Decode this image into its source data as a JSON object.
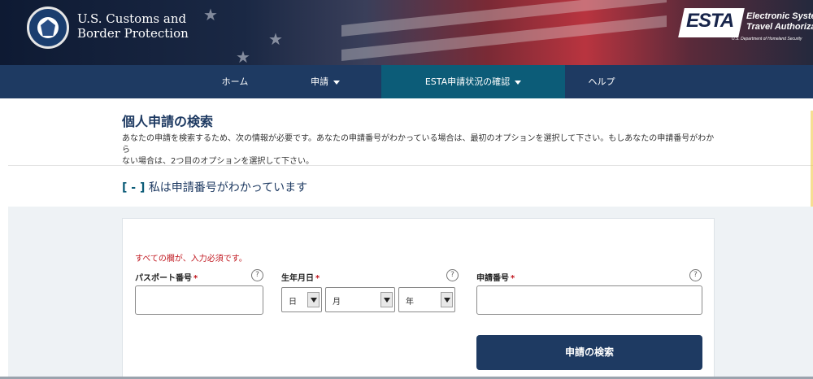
{
  "header": {
    "agency_line1": "U.S. Customs and",
    "agency_line2": "Border Protection",
    "esta_logo": "ESTA",
    "esta_line1": "Electronic System f",
    "esta_line2": "Travel Authorization",
    "esta_dhs": "U.S. Department of Homeland Security"
  },
  "nav": {
    "items": [
      {
        "label": "ホーム"
      },
      {
        "label": "申請"
      },
      {
        "label": "ESTA申請状況の確認"
      },
      {
        "label": "ヘルプ"
      }
    ]
  },
  "main": {
    "title": "個人申請の検索",
    "intro_line1": "あなたの申請を検索するため、次の情報が必要です。あなたの申請番号がわかっている場合は、最初のオプションを選択して下さい。もしあなたの申請番号がわから",
    "intro_line2": "ない場合は、2つ目のオプションを選択して下さい。",
    "toggle_mark": "[ - ]",
    "toggle_label": "私は申請番号がわかっています"
  },
  "form": {
    "required_note": "すべての欄が、入力必須です。",
    "required_marker": "*",
    "help_glyph": "?",
    "passport_label": "パスポート番号",
    "passport_value": "",
    "dob_label": "生年月日",
    "day_selected": "日",
    "month_selected": "月",
    "year_selected": "年",
    "app_number_label": "申請番号",
    "app_number_value": "",
    "search_button": "申請の検索"
  },
  "colors": {
    "nav_bg": "#1e3a62",
    "nav_active": "#0c5c78",
    "required": "#c0161e",
    "button": "#1e3a62"
  }
}
